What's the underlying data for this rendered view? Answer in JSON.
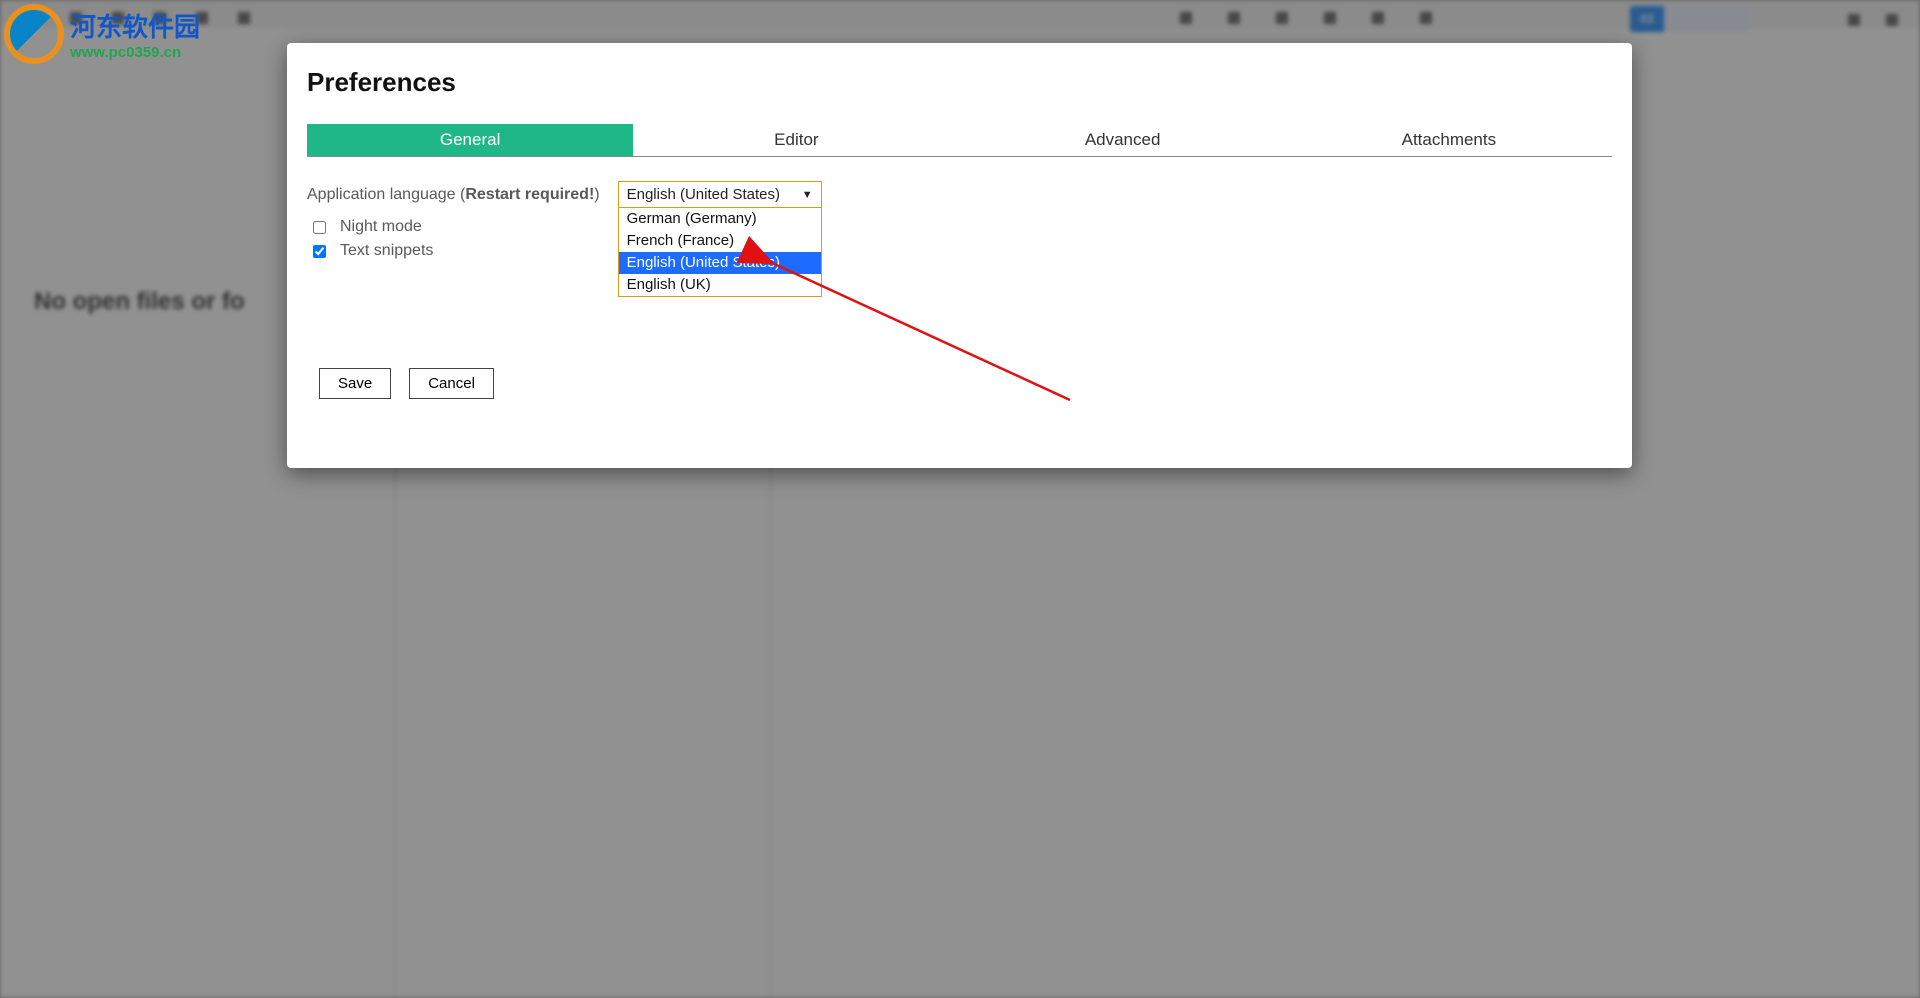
{
  "logo": {
    "cn": "河东软件园",
    "url": "www.pc0359.cn"
  },
  "background": {
    "empty_text": "No open files or fo"
  },
  "dialog": {
    "title": "Preferences",
    "tabs": {
      "general": "General",
      "editor": "Editor",
      "advanced": "Advanced",
      "attachments": "Attachments"
    },
    "form": {
      "language_label_pre": "Application language (",
      "language_label_bold": "Restart required!",
      "language_label_post": ")",
      "language_selected": "English (United States)",
      "language_options": {
        "de": "German (Germany)",
        "fr": "French (France)",
        "en_us": "English (United States)",
        "en_uk": "English (UK)"
      },
      "night_mode": "Night mode",
      "text_snippets": "Text snippets"
    },
    "buttons": {
      "save": "Save",
      "cancel": "Cancel"
    }
  }
}
